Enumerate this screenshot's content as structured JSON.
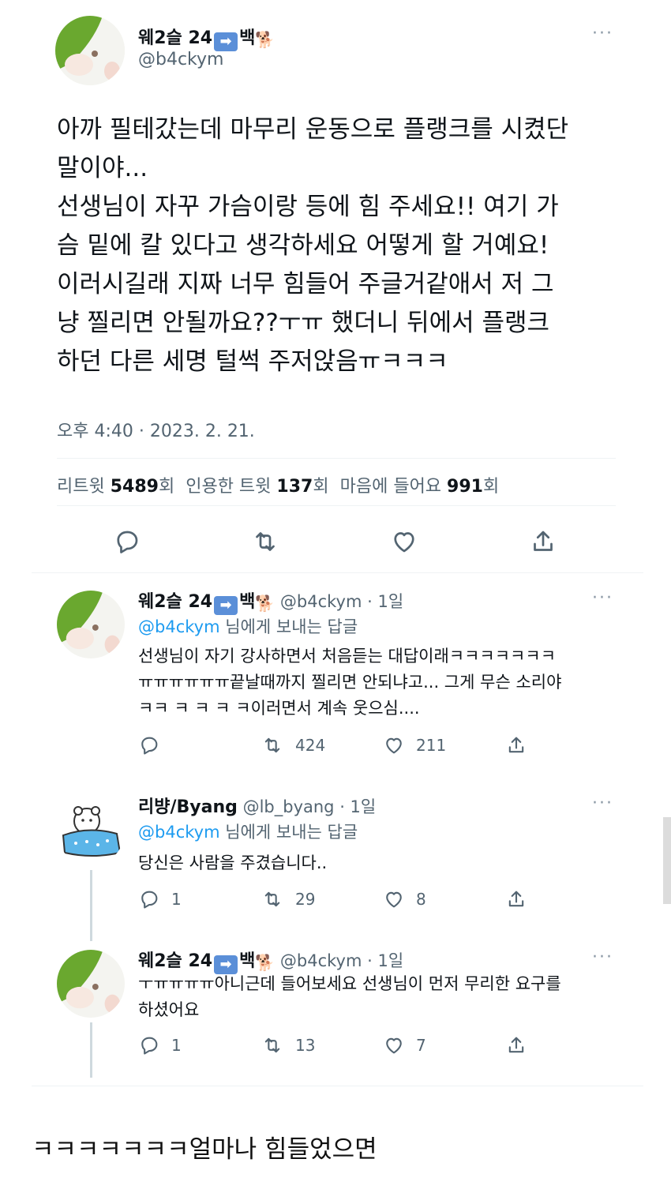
{
  "main_tweet": {
    "author_name": "웨2슬 24",
    "author_suffix": "백",
    "handle": "@b4ckym",
    "text": "아까 필테갔는데 마무리 운동으로 플랭크를 시켰단\n말이야...\n선생님이 자꾸 가슴이랑 등에 힘 주세요!! 여기 가\n슴 밑에 칼 있다고 생각하세요 어떻게 할 거예요!\n이러시길래 지짜 너무 힘들어 주글거같애서 저 그\n냥 찔리면 안될까요??ㅜㅠ 했더니 뒤에서 플랭크\n하던 다른 세명 털썩 주저앉음ㅠㅋㅋㅋ",
    "timestamp": "오후 4:40 · 2023. 2. 21.",
    "stats": {
      "retweets_label": "리트윗",
      "retweets": "5489",
      "retweets_unit": "회",
      "quotes_label": "인용한 트윗",
      "quotes": "137",
      "quotes_unit": "회",
      "likes_label": "마음에 들어요",
      "likes": "991",
      "likes_unit": "회"
    }
  },
  "replies": [
    {
      "author_name": "웨2슬 24",
      "author_suffix": "백",
      "handle": "@b4ckym",
      "time": "· 1일",
      "reply_to_handle": "@b4ckym",
      "reply_to_suffix": "님에게 보내는 답글",
      "text": "선생님이 자기 강사하면서 처음듣는 대답이래ㅋㅋㅋㅋㅋㅋㅋ\nㅠㅠㅠㅠㅠㅠ끝날때까지 찔리면 안되냐고... 그게 무슨 소리야\nㅋㅋ ㅋ ㅋ ㅋ ㅋ이러면서 계속 웃으심....",
      "replies_count": "",
      "retweets_count": "424",
      "likes_count": "211"
    },
    {
      "author_name": "리뱡/Byang",
      "author_suffix": "",
      "handle": "@lb_byang",
      "time": "· 1일",
      "reply_to_handle": "@b4ckym",
      "reply_to_suffix": "님에게 보내는 답글",
      "text": "당신은 사람을 주겼습니다..",
      "replies_count": "1",
      "retweets_count": "29",
      "likes_count": "8"
    },
    {
      "author_name": "웨2슬 24",
      "author_suffix": "백",
      "handle": "@b4ckym",
      "time": "· 1일",
      "reply_to_handle": "",
      "reply_to_suffix": "",
      "text": "ㅜㅠㅠㅠㅠ아니근데 들어보세요 선생님이 먼저 무리한 요구를\n하셨어요",
      "replies_count": "1",
      "retweets_count": "13",
      "likes_count": "7"
    }
  ],
  "caption": "ㅋㅋㅋㅋㅋㅋㅋ얼마나 힘들었으면",
  "icons": {
    "more": "more-icon",
    "reply": "reply-icon",
    "retweet": "retweet-icon",
    "like": "like-icon",
    "share": "share-icon",
    "arrow_badge": "right-arrow-badge-icon",
    "dog": "dog-emoji-icon"
  },
  "colors": {
    "link": "#1d9bf0",
    "muted": "#536471",
    "text": "#0f1419",
    "divider": "#eff3f4"
  }
}
